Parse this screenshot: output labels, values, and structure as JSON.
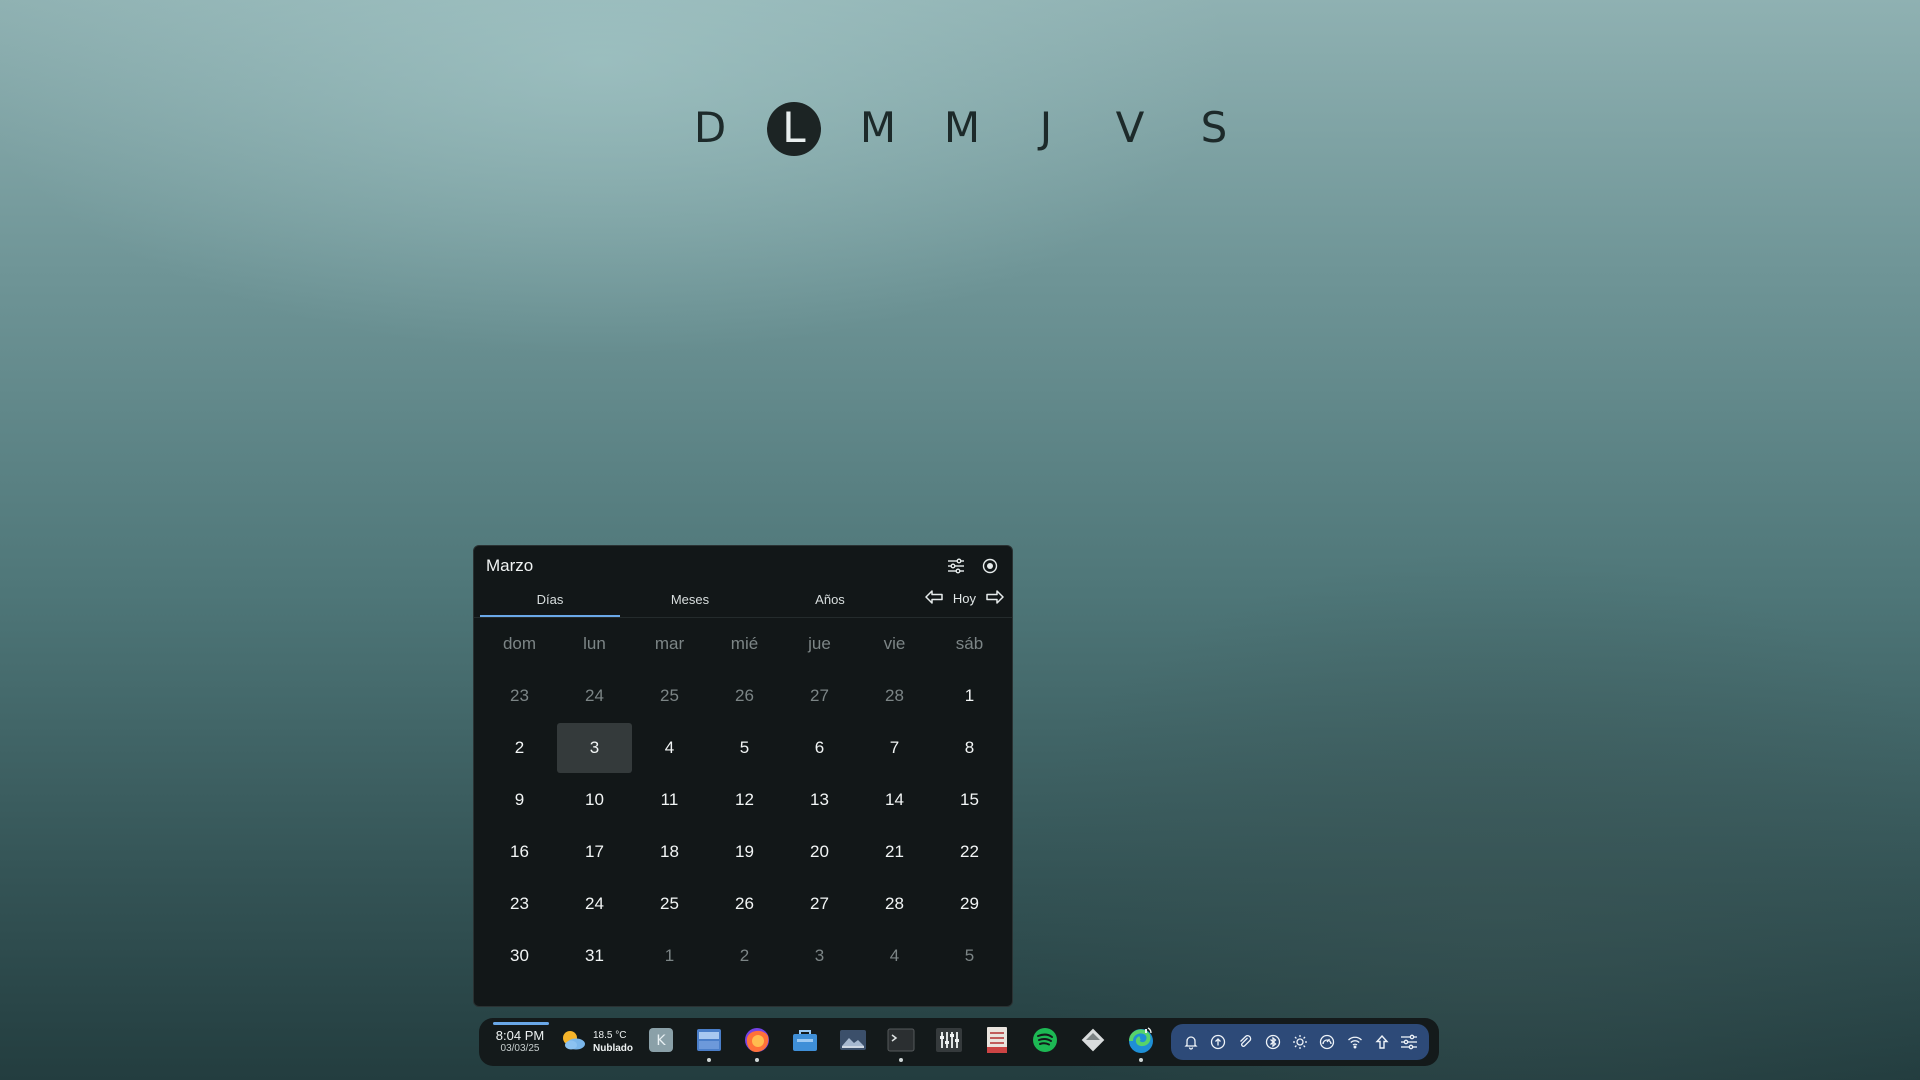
{
  "week_strip": {
    "letters": [
      "D",
      "L",
      "M",
      "M",
      "J",
      "V",
      "S"
    ],
    "active_index": 1
  },
  "calendar": {
    "title": "Marzo",
    "tabs": [
      "Días",
      "Meses",
      "Años"
    ],
    "active_tab": 0,
    "today_label": "Hoy",
    "weekdays": [
      "dom",
      "lun",
      "mar",
      "mié",
      "jue",
      "vie",
      "sáb"
    ],
    "weeks": [
      [
        {
          "d": "23",
          "m": true
        },
        {
          "d": "24",
          "m": true
        },
        {
          "d": "25",
          "m": true
        },
        {
          "d": "26",
          "m": true
        },
        {
          "d": "27",
          "m": true
        },
        {
          "d": "28",
          "m": true
        },
        {
          "d": "1"
        }
      ],
      [
        {
          "d": "2"
        },
        {
          "d": "3",
          "today": true
        },
        {
          "d": "4"
        },
        {
          "d": "5"
        },
        {
          "d": "6"
        },
        {
          "d": "7"
        },
        {
          "d": "8"
        }
      ],
      [
        {
          "d": "9"
        },
        {
          "d": "10"
        },
        {
          "d": "11"
        },
        {
          "d": "12"
        },
        {
          "d": "13"
        },
        {
          "d": "14"
        },
        {
          "d": "15"
        }
      ],
      [
        {
          "d": "16"
        },
        {
          "d": "17"
        },
        {
          "d": "18"
        },
        {
          "d": "19"
        },
        {
          "d": "20"
        },
        {
          "d": "21"
        },
        {
          "d": "22"
        }
      ],
      [
        {
          "d": "23"
        },
        {
          "d": "24"
        },
        {
          "d": "25"
        },
        {
          "d": "26"
        },
        {
          "d": "27"
        },
        {
          "d": "28"
        },
        {
          "d": "29"
        }
      ],
      [
        {
          "d": "30"
        },
        {
          "d": "31"
        },
        {
          "d": "1",
          "m": true
        },
        {
          "d": "2",
          "m": true
        },
        {
          "d": "3",
          "m": true
        },
        {
          "d": "4",
          "m": true
        },
        {
          "d": "5",
          "m": true
        }
      ]
    ]
  },
  "taskbar": {
    "time": "8:04 PM",
    "date": "03/03/25",
    "weather_temp": "18.5 °C",
    "weather_desc": "Nublado",
    "apps": [
      {
        "name": "kde-app-icon",
        "running": false
      },
      {
        "name": "file-manager-icon",
        "running": true
      },
      {
        "name": "firefox-icon",
        "running": true
      },
      {
        "name": "store-icon",
        "running": false
      },
      {
        "name": "image-viewer-icon",
        "running": false
      },
      {
        "name": "terminal-icon",
        "running": true
      },
      {
        "name": "mixer-icon",
        "running": false
      },
      {
        "name": "document-viewer-icon",
        "running": false
      },
      {
        "name": "spotify-icon",
        "running": false
      },
      {
        "name": "git-icon",
        "running": false
      },
      {
        "name": "edge-browser-icon",
        "running": true
      }
    ],
    "tray": [
      "notification-bell-icon",
      "update-icon",
      "clipboard-icon",
      "bluetooth-icon",
      "brightness-icon",
      "power-profile-icon",
      "wifi-icon",
      "upload-icon",
      "settings-sliders-icon"
    ]
  },
  "colors": {
    "accent": "#6aa8e8",
    "tray_bg": "#2d4a78",
    "panel_bg": "#121718"
  }
}
